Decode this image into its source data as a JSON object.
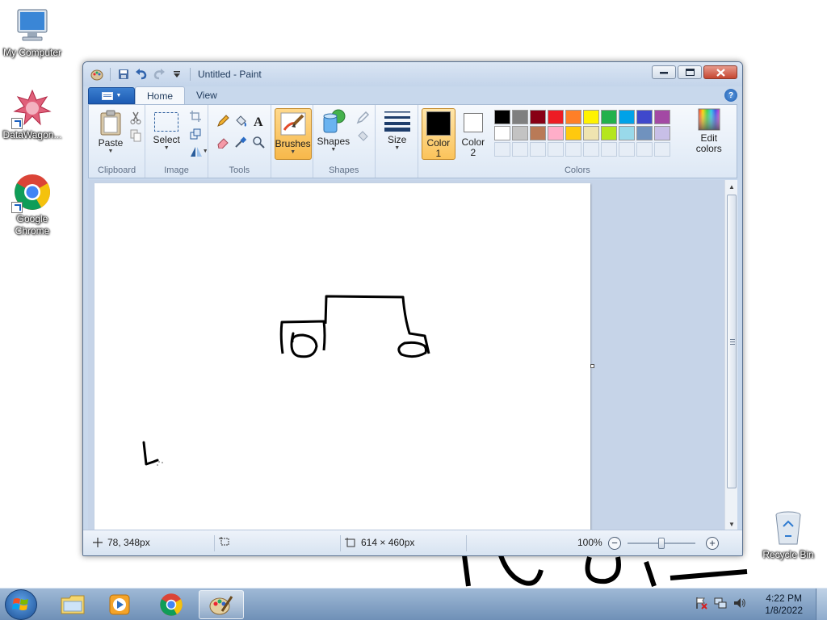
{
  "desktop": {
    "icons": [
      {
        "label": "My Computer",
        "icon": "computer-icon"
      },
      {
        "label": "DataWagon...",
        "icon": "datawagon-icon"
      },
      {
        "label": "Google Chrome",
        "icon": "chrome-icon"
      },
      {
        "label": "Recycle Bin",
        "icon": "recycle-bin-icon"
      }
    ]
  },
  "window": {
    "title": "Untitled - Paint",
    "controls": [
      "minimize",
      "maximize",
      "close"
    ]
  },
  "ribbon": {
    "tabs": [
      {
        "label": "Home",
        "active": true
      },
      {
        "label": "View",
        "active": false
      }
    ],
    "groups": {
      "clipboard": {
        "label": "Clipboard",
        "paste": "Paste"
      },
      "image": {
        "label": "Image",
        "select": "Select"
      },
      "tools": {
        "label": "Tools"
      },
      "brushes": {
        "label": "Brushes"
      },
      "shapes": {
        "label": "Shapes",
        "shapes_btn": "Shapes"
      },
      "size": {
        "label": "Size"
      },
      "colors": {
        "label": "Colors",
        "color1": {
          "line1": "Color",
          "line2": "1",
          "value": "#000000"
        },
        "color2": {
          "line1": "Color",
          "line2": "2",
          "value": "#ffffff"
        },
        "edit_colors": {
          "line1": "Edit",
          "line2": "colors"
        },
        "palette_row1": [
          "#000000",
          "#7f7f7f",
          "#880015",
          "#ed1c24",
          "#ff7f27",
          "#fff200",
          "#22b14c",
          "#00a2e8",
          "#3f48cc",
          "#a349a4"
        ],
        "palette_row2": [
          "#ffffff",
          "#c3c3c3",
          "#b97a57",
          "#ffaec9",
          "#ffc90e",
          "#efe4b0",
          "#b5e61d",
          "#99d9ea",
          "#7092be",
          "#c8bfe7"
        ]
      }
    }
  },
  "status": {
    "cursor_pos": "78, 348px",
    "canvas_size": "614 × 460px",
    "zoom": "100%"
  },
  "taskbar": {
    "items": [
      "explorer",
      "media-player",
      "chrome",
      "paint"
    ],
    "time": "4:22 PM",
    "date": "1/8/2022"
  }
}
